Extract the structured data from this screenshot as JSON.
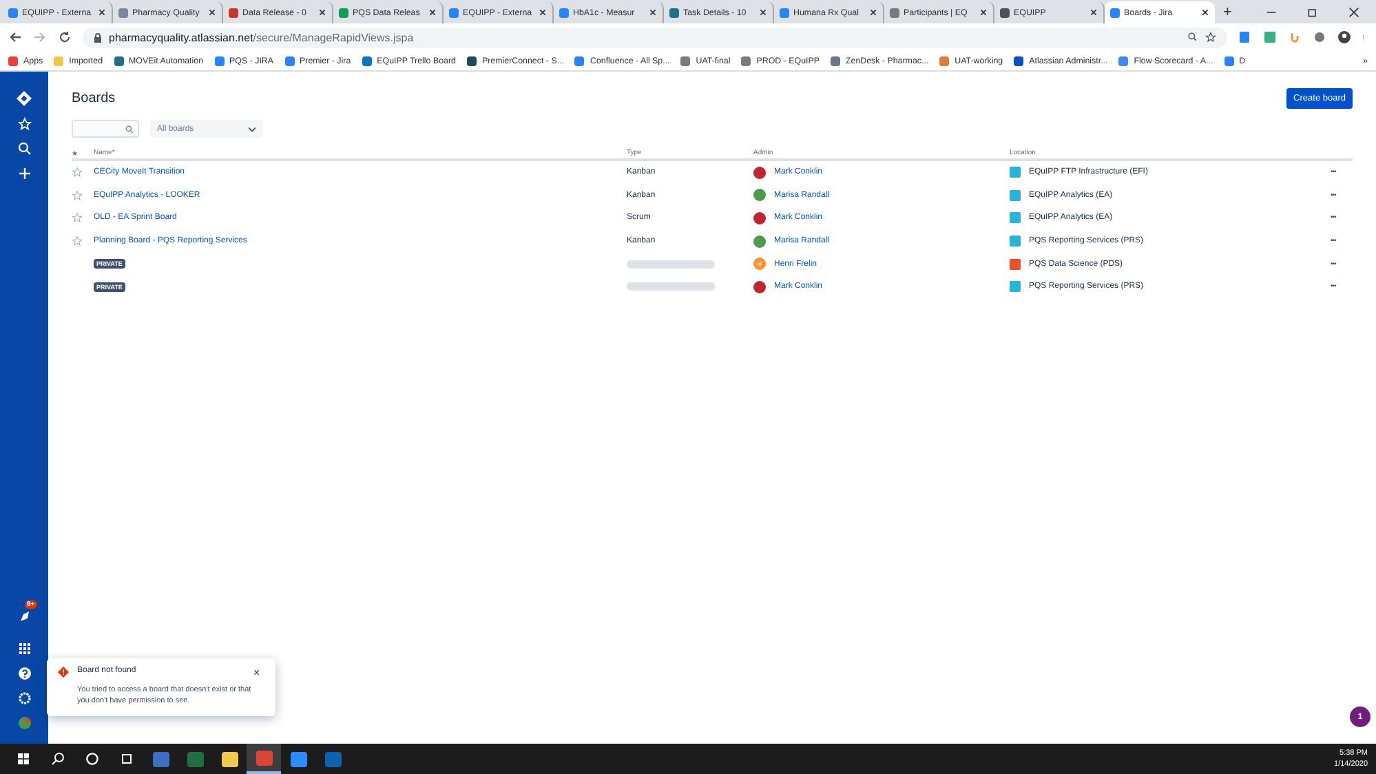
{
  "browser": {
    "tabs": [
      {
        "title": "EQUIPP - Externa",
        "selected": false,
        "color": "#2684ff"
      },
      {
        "title": "Pharmacy Quality",
        "selected": false,
        "color": "#7a869a"
      },
      {
        "title": "Data Release - 0",
        "selected": false,
        "color": "#c9372c"
      },
      {
        "title": "PQS Data Releas",
        "selected": false,
        "color": "#0f9d58"
      },
      {
        "title": "EQUIPP - Externa",
        "selected": false,
        "color": "#2684ff"
      },
      {
        "title": "HbA1c - Measur",
        "selected": false,
        "color": "#2684ff"
      },
      {
        "title": "Task Details - 10",
        "selected": false,
        "color": "#1f6f8b"
      },
      {
        "title": "Humana Rx Qual",
        "selected": false,
        "color": "#2684ff"
      },
      {
        "title": "Participants | EQ",
        "selected": false,
        "color": "#7a7a7a"
      },
      {
        "title": "EQUIPP",
        "selected": false,
        "color": "#505050"
      },
      {
        "title": "Boards - Jira",
        "selected": true,
        "color": "#2684ff"
      }
    ],
    "new_tab": "+",
    "url_host": "pharmacyquality.atlassian.net",
    "url_path": "/secure/ManageRapidViews.jspa",
    "bookmarks": [
      {
        "label": "Apps",
        "color": "#e94235"
      },
      {
        "label": "Imported",
        "color": "#f4c542"
      },
      {
        "label": "MOVEit Automation",
        "color": "#1f6f8b"
      },
      {
        "label": "PQS - JIRA",
        "color": "#2684ff"
      },
      {
        "label": "Premier - Jira",
        "color": "#2684ff"
      },
      {
        "label": "EQuIPP Trello Board",
        "color": "#0079bf"
      },
      {
        "label": "PremierConnect - S...",
        "color": "#1d4f5a"
      },
      {
        "label": "Confluence - All Sp...",
        "color": "#2684ff"
      },
      {
        "label": "UAT-final",
        "color": "#7a7a7a"
      },
      {
        "label": "PROD - EQuIPP",
        "color": "#7a7a7a"
      },
      {
        "label": "ZenDesk - Pharmac...",
        "color": "#6b778c"
      },
      {
        "label": "UAT-working",
        "color": "#e07b39"
      },
      {
        "label": "Atlassian Administr...",
        "color": "#0052cc"
      },
      {
        "label": "Flow Scorecard - A...",
        "color": "#4285f4"
      },
      {
        "label": "D",
        "color": "#2684ff"
      }
    ],
    "bookmarks_more": "»"
  },
  "sidebar": {
    "notification_count": "9+"
  },
  "page": {
    "title": "Boards",
    "create_button": "Create board",
    "filter": "All boards",
    "columns": {
      "star": "★",
      "name": "Name*",
      "type": "Type",
      "admin": "Admin",
      "location": "Location"
    },
    "rows": [
      {
        "kind": "board",
        "name": "CECity MoveIt Transition",
        "type": "Kanban",
        "admin": {
          "name": "Mark Conklin",
          "color": "#c0262d"
        },
        "location": {
          "name": "EQuIPP FTP Infrastructure (EFI)",
          "color": "#26b5d8"
        }
      },
      {
        "kind": "board",
        "name": "EQuIPP Analytics - LOOKER",
        "type": "Kanban",
        "admin": {
          "name": "Marisa Randall",
          "color": "#4c9a4a"
        },
        "location": {
          "name": "EQuIPP Analytics (EA)",
          "color": "#26b5d8"
        }
      },
      {
        "kind": "board",
        "name": "OLD - EA Sprint Board",
        "type": "Scrum",
        "admin": {
          "name": "Mark Conklin",
          "color": "#c0262d"
        },
        "location": {
          "name": "EQuIPP Analytics (EA)",
          "color": "#26b5d8"
        }
      },
      {
        "kind": "board",
        "name": "Planning Board - PQS Reporting Services",
        "type": "Kanban",
        "admin": {
          "name": "Marisa Randall",
          "color": "#4c9a4a"
        },
        "location": {
          "name": "PQS Reporting Services (PRS)",
          "color": "#26b5d8"
        }
      },
      {
        "kind": "private",
        "name": "PRIVATE",
        "admin": {
          "name": "Henri Frelin",
          "initials": "HF",
          "color": "#f79232"
        },
        "location": {
          "name": "PQS Data Science (PDS)",
          "color": "#e8502a"
        }
      },
      {
        "kind": "private",
        "name": "PRIVATE",
        "admin": {
          "name": "Mark Conklin",
          "color": "#c0262d"
        },
        "location": {
          "name": "PQS Reporting Services (PRS)",
          "color": "#26b5d8"
        }
      }
    ],
    "row_menu": "•••"
  },
  "flag": {
    "title": "Board not found",
    "message": "You tried to access a board that doesn't exist or that you don't have permission to see.",
    "close": "×"
  },
  "chat_badge": "1",
  "taskbar": {
    "apps": [
      {
        "selected": false,
        "color": "#3a6fc4"
      },
      {
        "selected": false,
        "color": "#1d7044"
      },
      {
        "selected": false,
        "color": "#f2c94c"
      },
      {
        "selected": true,
        "color": "#db4437"
      },
      {
        "selected": false,
        "color": "#2d8cff"
      },
      {
        "selected": false,
        "color": "#0a64ad"
      }
    ],
    "time": "5:38 PM",
    "date": "1/14/2020"
  }
}
